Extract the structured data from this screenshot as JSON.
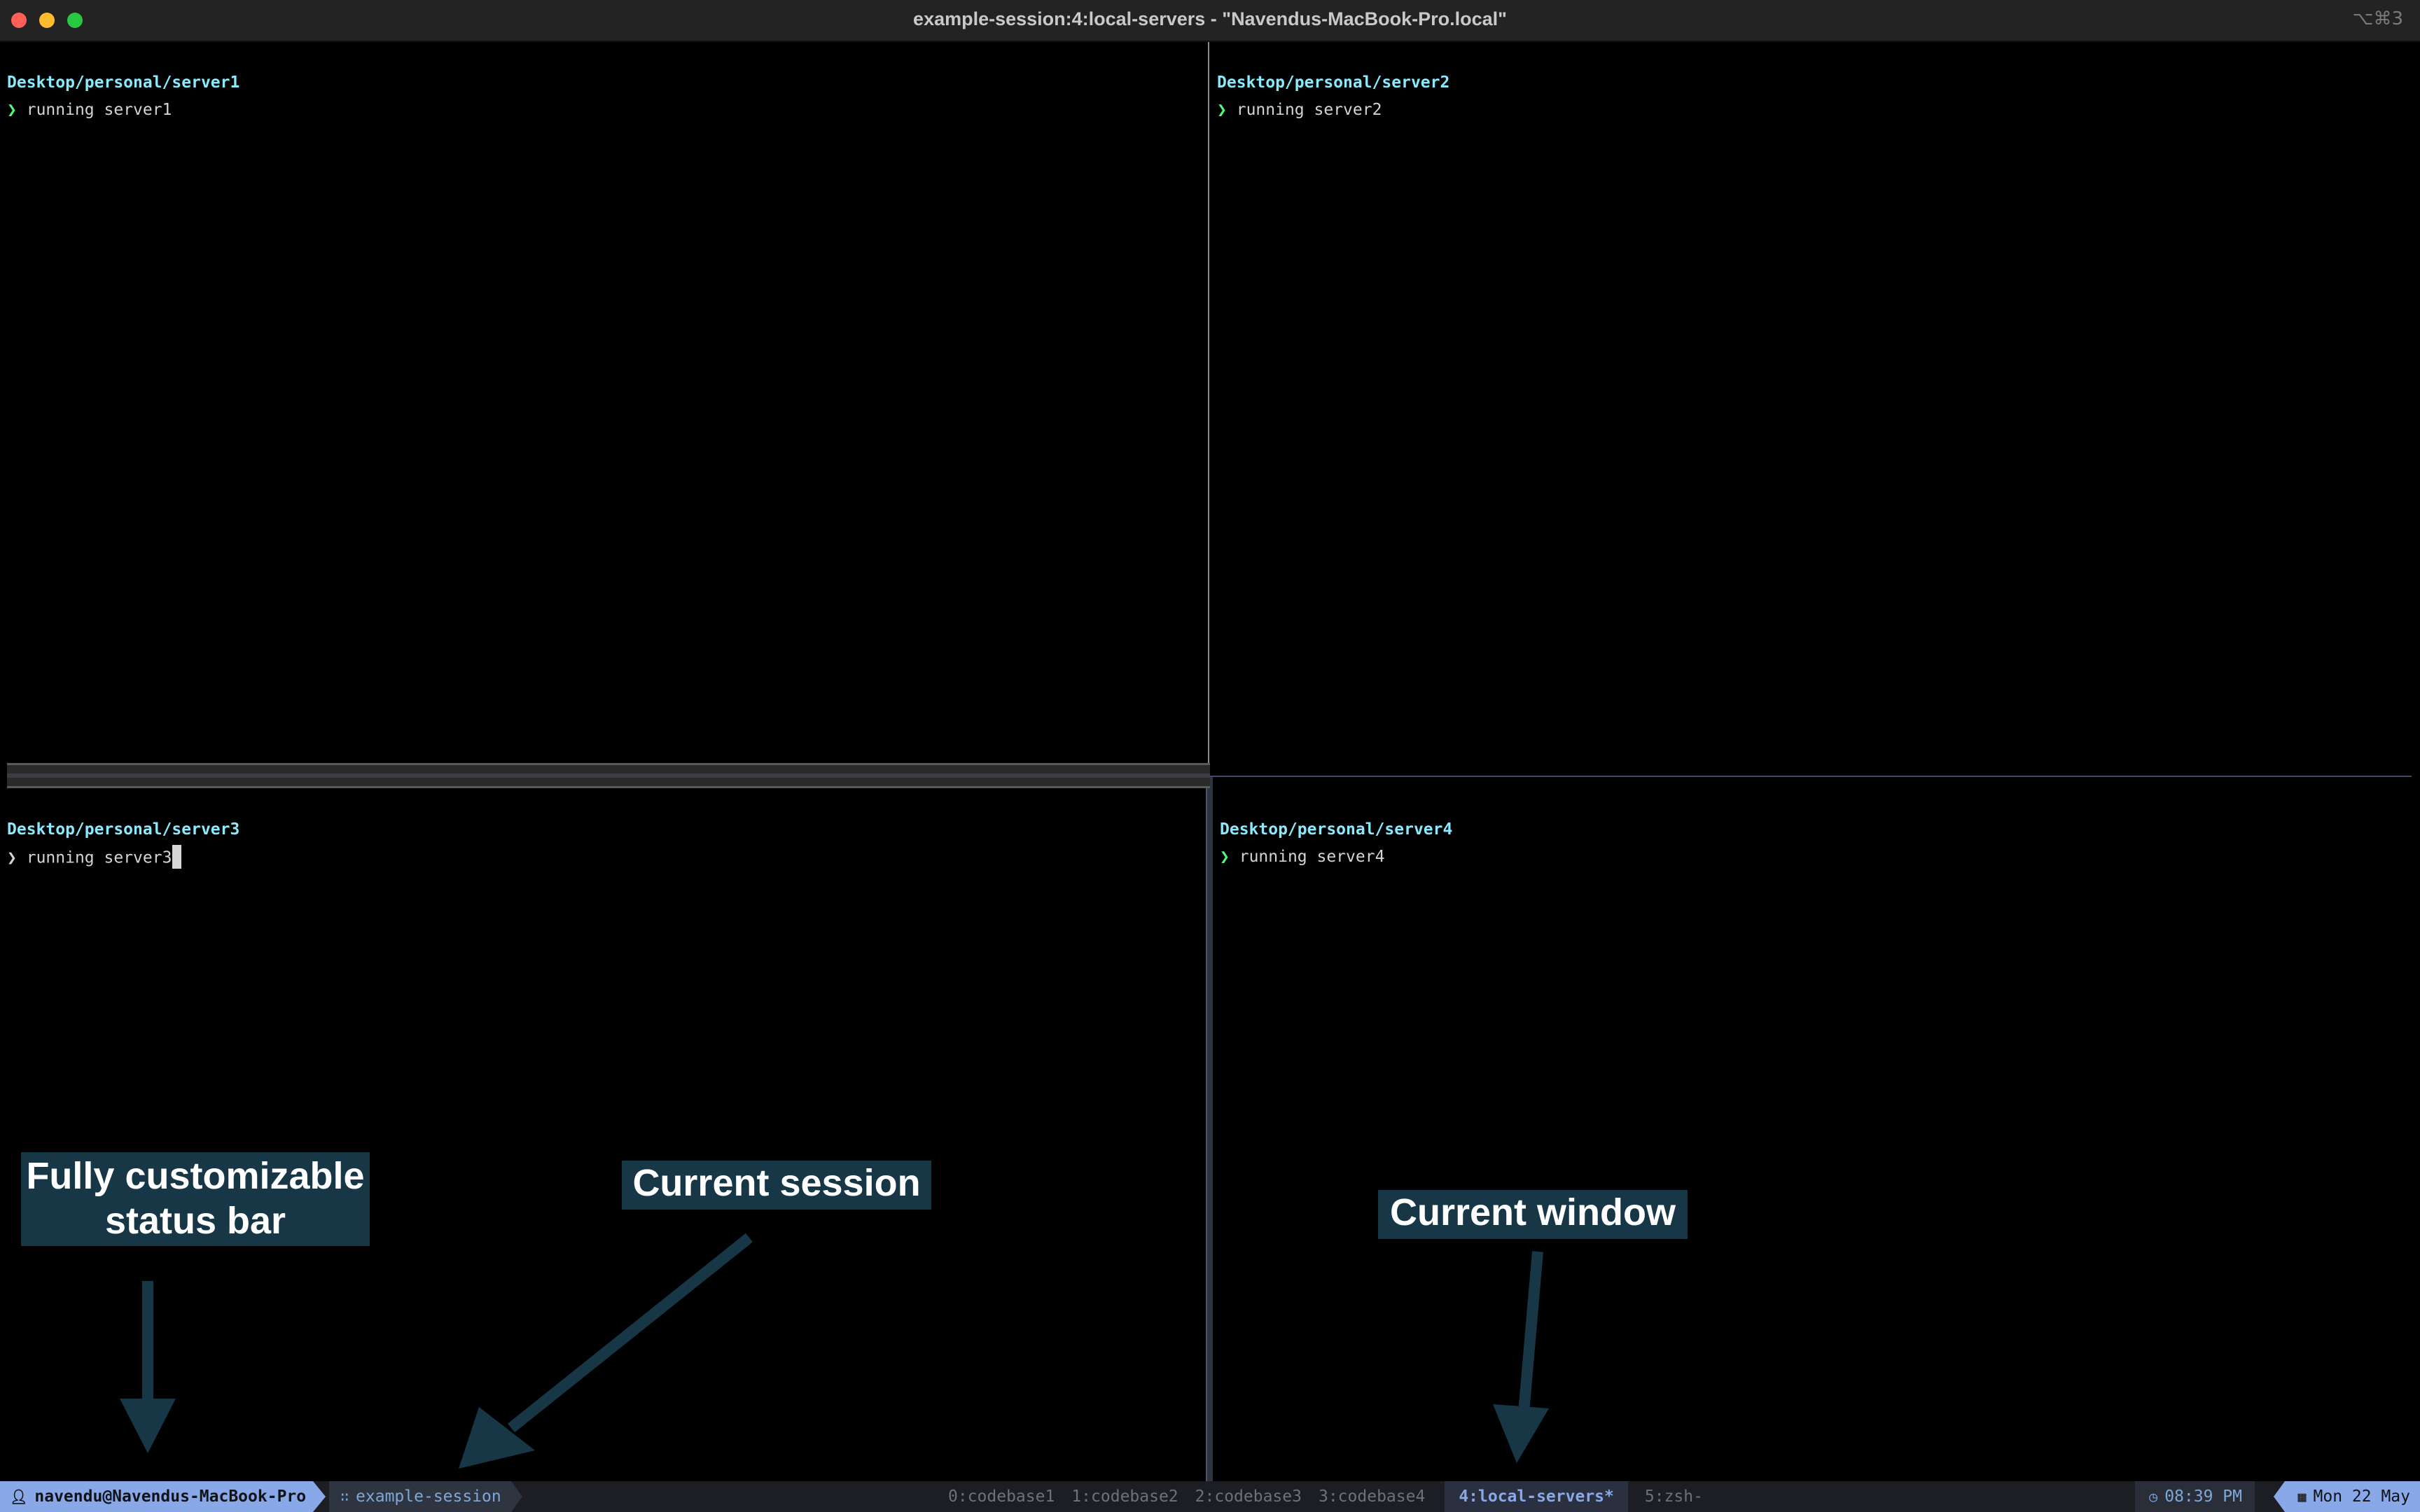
{
  "window": {
    "title": "example-session:4:local-servers - \"Navendus-MacBook-Pro.local\"",
    "shortcut": "⌥⌘3"
  },
  "panes": [
    {
      "path": "Desktop/personal/server1",
      "prompt": "❯",
      "command": "running server1"
    },
    {
      "path": "Desktop/personal/server2",
      "prompt": "❯",
      "command": "running server2"
    },
    {
      "path": "Desktop/personal/server3",
      "prompt": "❯",
      "command": "running server3"
    },
    {
      "path": "Desktop/personal/server4",
      "prompt": "❯",
      "command": "running server4"
    }
  ],
  "annotations": {
    "status_bar_line1": "Fully customizable",
    "status_bar_line2": "status bar",
    "current_session": "Current session",
    "current_window": "Current window"
  },
  "statusbar": {
    "user_icon": "user-icon",
    "user": "navendu@Navendus-MacBook-Pro",
    "session_icon": "grid-icon",
    "session": "example-session",
    "windows": [
      "0:codebase1",
      "1:codebase2",
      "2:codebase3",
      "3:codebase4",
      "4:local-servers*",
      "5:zsh-"
    ],
    "active_window_index": 4,
    "time_icon": "clock-icon",
    "time": "08:39 PM",
    "date_icon": "calendar-icon",
    "date": "Mon 22 May"
  },
  "colors": {
    "path": "#8be9fd",
    "prompt": "#50fa7b",
    "accent": "#88a8e8",
    "annotation_bg": "#173747"
  }
}
